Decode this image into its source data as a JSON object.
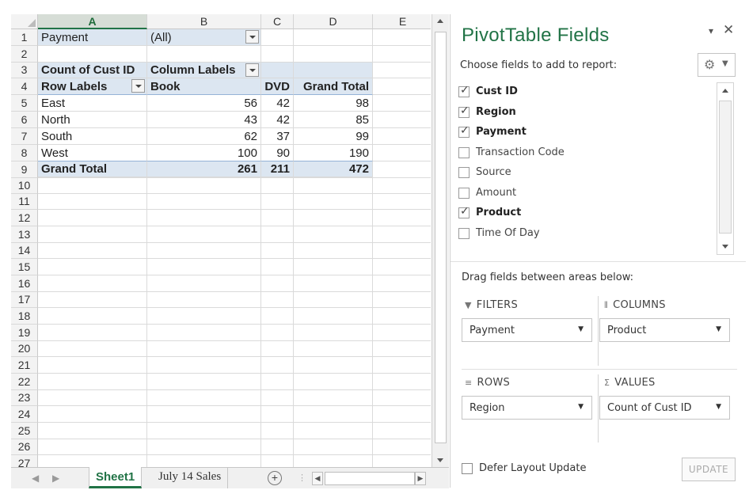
{
  "sheet": {
    "columns": [
      "A",
      "B",
      "C",
      "D",
      "E"
    ],
    "selected_column": "A",
    "rows": [
      "1",
      "2",
      "3",
      "4",
      "5",
      "6",
      "7",
      "8",
      "9",
      "10",
      "11",
      "12",
      "13",
      "14",
      "15",
      "16",
      "17",
      "18",
      "19",
      "20",
      "21",
      "22",
      "23",
      "24",
      "25",
      "26",
      "27"
    ],
    "filter_row": {
      "label": "Payment",
      "value": "(All)"
    },
    "pivot_header": {
      "count_label": "Count of Cust ID",
      "column_labels": "Column Labels"
    },
    "pivot_col_headers": {
      "row_labels": "Row Labels",
      "book": "Book",
      "dvd": "DVD",
      "grand_total": "Grand Total"
    },
    "pivot_rows": [
      {
        "label": "East",
        "book": "56",
        "dvd": "42",
        "total": "98"
      },
      {
        "label": "North",
        "book": "43",
        "dvd": "42",
        "total": "85"
      },
      {
        "label": "South",
        "book": "62",
        "dvd": "37",
        "total": "99"
      },
      {
        "label": "West",
        "book": "100",
        "dvd": "90",
        "total": "190"
      }
    ],
    "grand_total_row": {
      "label": "Grand Total",
      "book": "261",
      "dvd": "211",
      "total": "472"
    }
  },
  "tabs": {
    "active": "Sheet1",
    "inactive": "July 14 Sales",
    "add_symbol": "+"
  },
  "pane": {
    "title": "PivotTable Fields",
    "dropdown_symbol": "▾",
    "close_symbol": "✕",
    "choose_label": "Choose fields to add to report:",
    "fields": [
      {
        "name": "Cust ID",
        "checked": true
      },
      {
        "name": "Region",
        "checked": true
      },
      {
        "name": "Payment",
        "checked": true
      },
      {
        "name": "Transaction Code",
        "checked": false
      },
      {
        "name": "Source",
        "checked": false
      },
      {
        "name": "Amount",
        "checked": false
      },
      {
        "name": "Product",
        "checked": true
      },
      {
        "name": "Time Of Day",
        "checked": false
      }
    ],
    "drag_label": "Drag fields between areas below:",
    "areas": {
      "filters": {
        "title": "FILTERS",
        "value": "Payment"
      },
      "columns": {
        "title": "COLUMNS",
        "value": "Product"
      },
      "rows": {
        "title": "ROWS",
        "value": "Region"
      },
      "values": {
        "title": "VALUES",
        "value": "Count of Cust ID"
      }
    },
    "defer_label": "Defer Layout Update",
    "update_label": "UPDATE"
  },
  "colors": {
    "accent_green": "#217346",
    "pivot_header_blue": "#dce6f1"
  }
}
